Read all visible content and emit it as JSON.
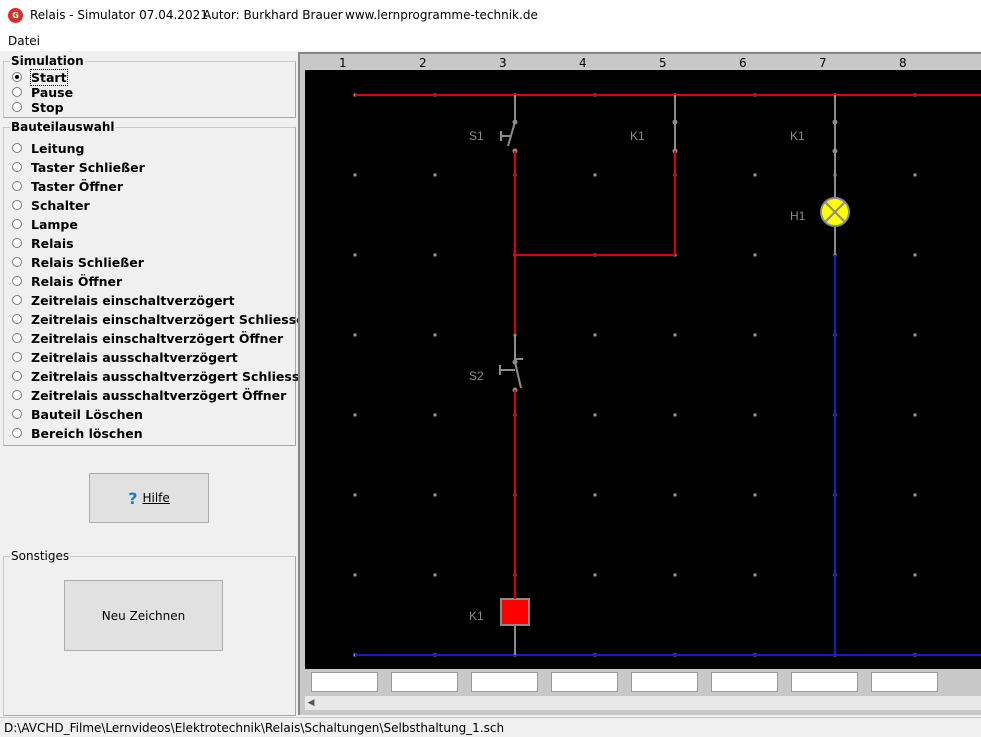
{
  "window": {
    "title": "Relais - Simulator  07.04.2021",
    "author": "Autor: Burkhard Brauer",
    "website": "www.lernprogramme-technik.de"
  },
  "menu": {
    "file": "Datei"
  },
  "simulation": {
    "title": "Simulation",
    "options": [
      "Start",
      "Pause",
      "Stop"
    ],
    "selected": "Start"
  },
  "bauteilauswahl": {
    "title": "Bauteilauswahl",
    "options": [
      "Leitung",
      "Taster Schließer",
      "Taster Öffner",
      "Schalter",
      "Lampe",
      "Relais",
      "Relais Schließer",
      "Relais Öffner",
      "Zeitrelais einschaltverzögert",
      "Zeitrelais einschaltverzögert Schliesser",
      "Zeitrelais einschaltverzögert Öffner",
      "Zeitrelais ausschaltverzögert",
      "Zeitrelais ausschaltverzögert Schliesser",
      "Zeitrelais ausschaltverzögert Öffner",
      "Bauteil Löschen",
      "Bereich löschen"
    ]
  },
  "help_button": {
    "icon": "question-mark-icon",
    "label": "Hilfe"
  },
  "sonstiges": {
    "title": "Sonstiges",
    "redraw_label": "Neu Zeichnen"
  },
  "grid": {
    "columns": [
      "1",
      "2",
      "3",
      "4",
      "5",
      "6",
      "7",
      "8"
    ],
    "component_labels": {
      "s1": "S1",
      "k1_contact_a": "K1",
      "k1_contact_b": "K1",
      "h1": "H1",
      "s2": "S2",
      "k1_coil": "K1"
    }
  },
  "colors": {
    "phase": "#e00000",
    "neutral": "#1a1acc",
    "inactive": "#8c8c8c",
    "lamp": "#ffff00",
    "coil": "#ff0000",
    "canvas": "#000000"
  },
  "status": {
    "path": "D:\\AVCHD_Filme\\Lernvideos\\Elektrotechnik\\Relais\\Schaltungen\\Selbsthaltung_1.sch"
  }
}
